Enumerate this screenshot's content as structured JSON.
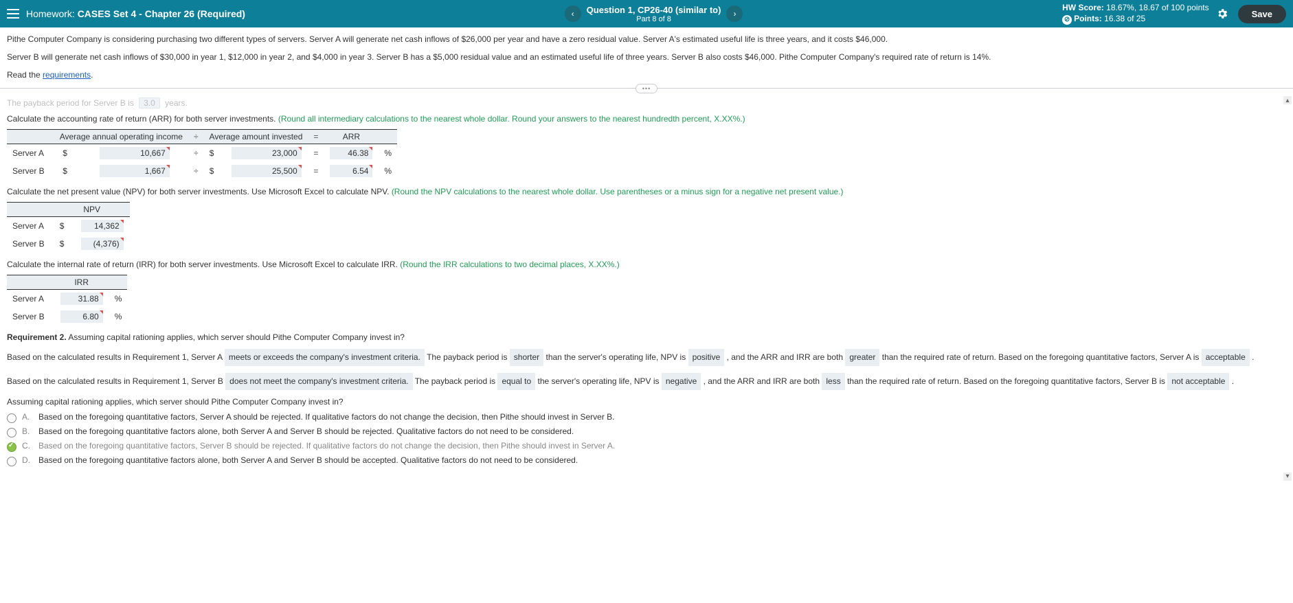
{
  "header": {
    "homework_label": "Homework:",
    "assignment_title": "CASES Set 4 - Chapter 26 (Required)",
    "question_line1": "Question 1, CP26-40 (similar to)",
    "question_line2": "Part 8 of 8",
    "hw_score_label": "HW Score:",
    "hw_score_value": "18.67%, 18.67 of 100 points",
    "points_label": "Points:",
    "points_value": "16.38 of 25",
    "save_label": "Save"
  },
  "problem": {
    "p1": "Pithe Computer Company is considering purchasing two different types of servers. Server A will generate net cash inflows of $26,000 per year and have a zero residual value. Server A's estimated useful life is three years, and it costs $46,000.",
    "p2": "Server B will generate net cash inflows of $30,000 in year 1, $12,000 in year 2, and $4,000 in year 3. Server B has a $5,000 residual value and an estimated useful life of three years. Server B also costs $46,000. Pithe Computer Company's required rate of return is 14%.",
    "read_the": "Read the ",
    "requirements_link": "requirements",
    "period": "."
  },
  "cutoff": {
    "text_a": "The payback period for Server B is",
    "value": "3.0",
    "text_b": "years."
  },
  "arr": {
    "instr_text": "Calculate the accounting rate of return (ARR) for both server investments. ",
    "instr_hint": "(Round all intermediary calculations to the nearest whole dollar. Round your answers to the nearest hundredth percent, X.XX%.)",
    "col1": "Average annual operating income",
    "col2": "Average amount invested",
    "col3": "ARR",
    "rowA_label": "Server A",
    "rowA_income": "10,667",
    "rowA_invested": "23,000",
    "rowA_arr": "46.38",
    "rowB_label": "Server B",
    "rowB_income": "1,667",
    "rowB_invested": "25,500",
    "rowB_arr": "6.54"
  },
  "npv": {
    "instr_text": "Calculate the net present value (NPV) for both server investments. Use Microsoft Excel to calculate NPV. ",
    "instr_hint": "(Round the NPV calculations to the nearest whole dollar. Use parentheses or a minus sign for a negative net present value.)",
    "col": "NPV",
    "rowA_label": "Server A",
    "rowA_val": "14,362",
    "rowB_label": "Server B",
    "rowB_val": "(4,376)"
  },
  "irr": {
    "instr_text": "Calculate the internal rate of return (IRR) for both server investments. Use Microsoft Excel to calculate IRR. ",
    "instr_hint": "(Round the IRR calculations to two decimal places, X.XX%.)",
    "col": "IRR",
    "rowA_label": "Server A",
    "rowA_val": "31.88",
    "rowB_label": "Server B",
    "rowB_val": "6.80"
  },
  "req2": {
    "heading": "Requirement 2.",
    "heading_rest": " Assuming capital rationing applies, which server should Pithe Computer Company invest in?",
    "a_pre1": "Based on the calculated results in Requirement 1, Server A ",
    "a_ans1": "meets or exceeds the company's investment criteria.",
    "a_mid1": " The payback period is ",
    "a_ans2": "shorter",
    "a_mid2": " than the server's operating life, NPV is ",
    "a_ans3": "positive",
    "a_mid3": " , and the ARR and IRR are both ",
    "a_ans4": "greater",
    "a_mid4": " than the required rate of return. Based on the foregoing quantitative factors, Server A is ",
    "a_ans5": "acceptable",
    "a_end": " .",
    "b_pre1": "Based on the calculated results in Requirement 1, Server B ",
    "b_ans1": "does not meet the company's investment criteria.",
    "b_mid1": " The payback period is ",
    "b_ans2": "equal to",
    "b_mid2": " the server's operating life, NPV is ",
    "b_ans3": "negative",
    "b_mid3": " , and the ARR and IRR are both ",
    "b_ans4": "less",
    "b_mid4": " than the required rate of return. Based on the foregoing quantitative factors, Server B is ",
    "b_ans5": "not acceptable",
    "b_end": " .",
    "final_q": "Assuming capital rationing applies, which server should Pithe Computer Company invest in?"
  },
  "mc": {
    "a": "Based on the foregoing quantitative factors, Server A should be rejected. If qualitative factors do not change the decision, then Pithe should invest in Server B.",
    "b": "Based on the foregoing quantitative factors alone, both Server A and Server B should be rejected. Qualitative factors do not need to be considered.",
    "c": "Based on the foregoing quantitative factors, Server B should be rejected. If qualitative factors do not change the decision, then Pithe should invest in Server A.",
    "d": "Based on the foregoing quantitative factors alone, both Server A and Server B should be accepted. Qualitative factors do not need to be considered."
  }
}
